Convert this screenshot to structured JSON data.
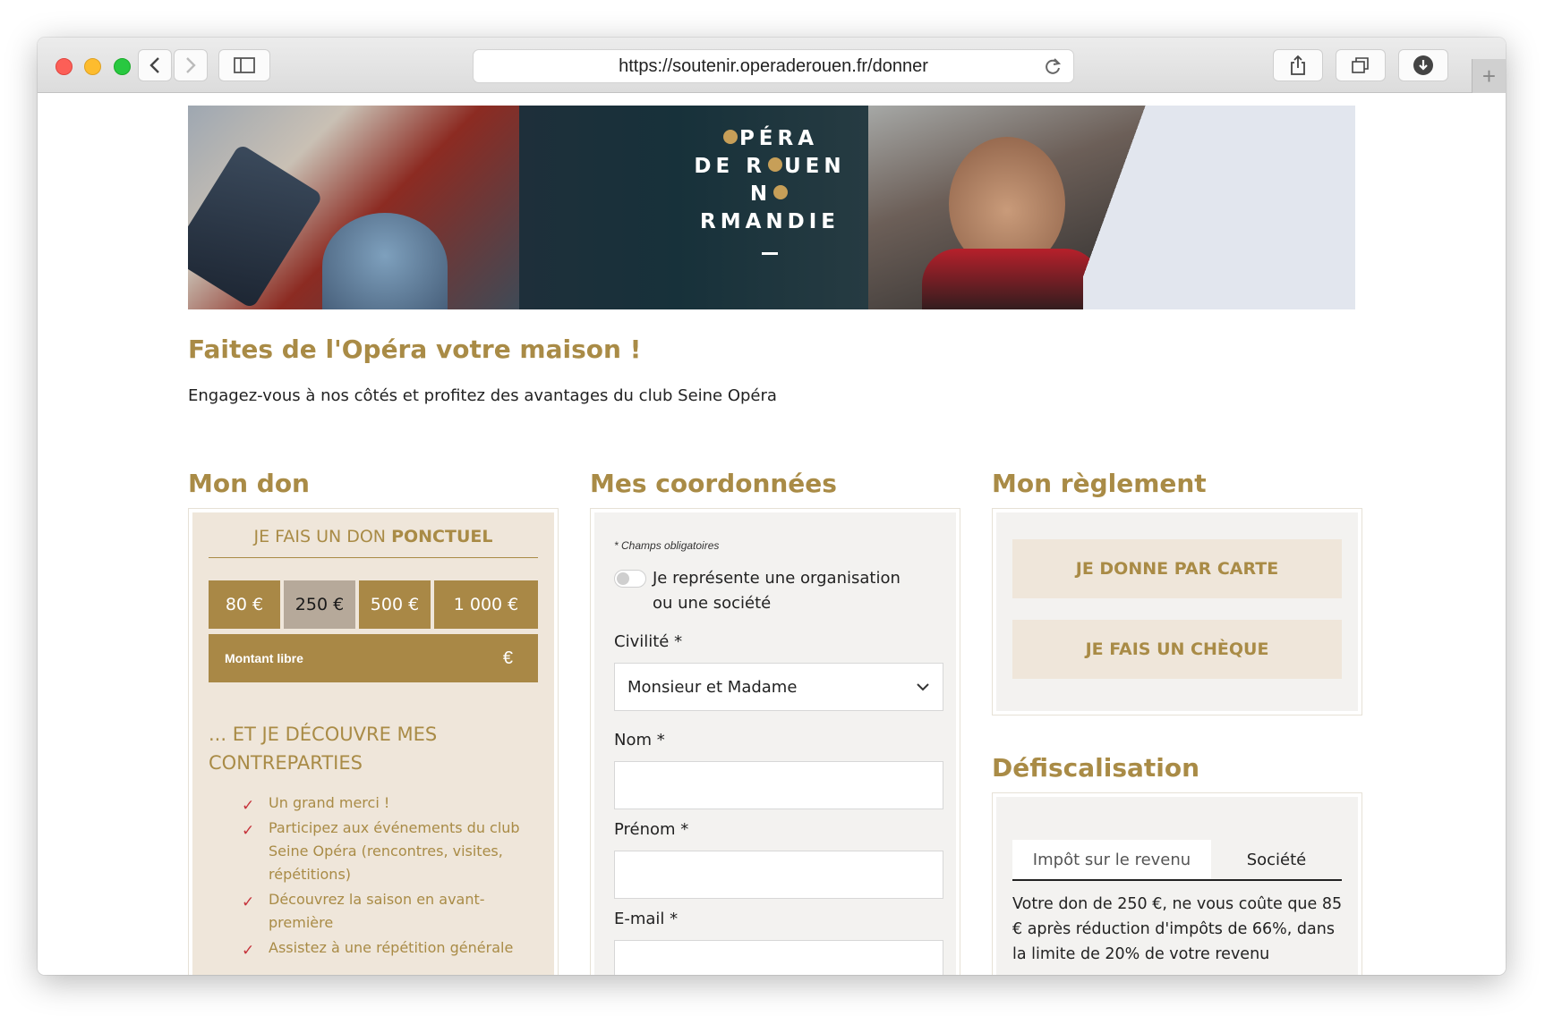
{
  "browser": {
    "url": "https://soutenir.operaderouen.fr/donner"
  },
  "banner": {
    "logo_line1_pre": "",
    "logo_line1_post": "PÉRA",
    "logo_line2_pre": "DE R",
    "logo_line2_post": "UEN",
    "logo_line3_pre": "N",
    "logo_line3_post": "RMANDIE"
  },
  "page": {
    "headline": "Faites de l'Opéra votre maison !",
    "intro": "Engagez-vous à nos côtés et profitez des avantages du club Seine Opéra"
  },
  "don": {
    "title_light": "Mon ",
    "title_bold": "don",
    "header_light": "JE FAIS UN DON ",
    "header_bold": "PONCTUEL",
    "amounts": [
      {
        "label": "80 €",
        "selected": false
      },
      {
        "label": "250 €",
        "selected": true
      },
      {
        "label": "500 €",
        "selected": false
      },
      {
        "label": "1 000 €",
        "selected": false
      }
    ],
    "free_amount_label": "Montant libre",
    "currency": "€",
    "contreparties_title": "... ET JE DÉCOUVRE MES CONTREPARTIES",
    "benefits": [
      "Un grand merci !",
      "Participez aux événements du club Seine Opéra (rencontres, visites, répétitions)",
      "Découvrez la saison en avant-première",
      "Assistez à une répétition générale"
    ]
  },
  "coordonnees": {
    "title_light": "Mes ",
    "title_bold": "coordonnées",
    "required_note": "* Champs obligatoires",
    "org_toggle_label": "Je représente une organisation ou une société",
    "civilite_label": "Civilité *",
    "civilite_value": "Monsieur et Madame",
    "nom_label": "Nom *",
    "prenom_label": "Prénom *",
    "email_label": "E-mail *"
  },
  "reglement": {
    "title_light": "Mon ",
    "title_bold": "règlement",
    "card_button": "JE DONNE PAR CARTE",
    "cheque_button": "JE FAIS UN CHÈQUE"
  },
  "defiscalisation": {
    "title": "Défiscalisation",
    "tabs": [
      "Impôt sur le revenu",
      "Société"
    ],
    "active_tab": "Société",
    "text": "Votre don de 250 €, ne vous coûte que 85 € après réduction d'impôts de 66%, dans la limite de 20% de votre revenu"
  },
  "colors": {
    "gold": "#a98846",
    "beige": "#efe6da",
    "selected_amount": "#b6a99a",
    "check_red": "#c6343c"
  }
}
